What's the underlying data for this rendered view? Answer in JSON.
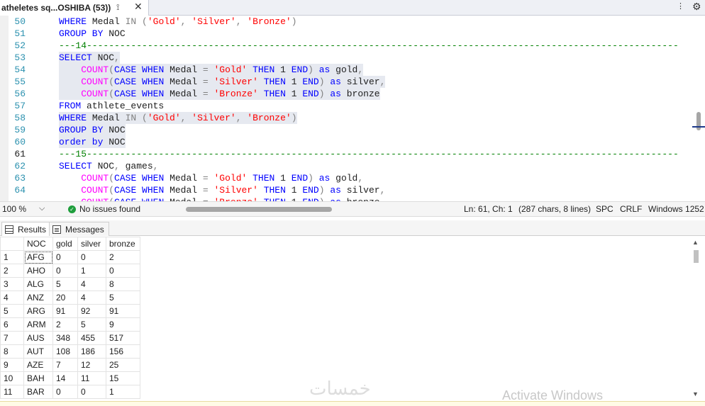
{
  "tab": {
    "title": "atheletes sq...OSHIBA (53))",
    "pin_glyph": "⟟",
    "close_glyph": "✕",
    "dropdown_glyph": "⋮",
    "settings_glyph": "⚙"
  },
  "editor": {
    "lines": [
      {
        "num": "50",
        "tokens": [
          [
            "kw",
            "WHERE "
          ],
          [
            "pl",
            "Medal "
          ],
          [
            "op",
            "IN "
          ],
          [
            "op",
            "("
          ],
          [
            "str",
            "'Gold'"
          ],
          [
            "op",
            ", "
          ],
          [
            "str",
            "'Silver'"
          ],
          [
            "op",
            ", "
          ],
          [
            "str",
            "'Bronze'"
          ],
          [
            "op",
            ")"
          ]
        ]
      },
      {
        "num": "51",
        "tokens": [
          [
            "kw",
            "GROUP BY "
          ],
          [
            "pl",
            "NOC"
          ]
        ]
      },
      {
        "num": "52",
        "tokens": [
          [
            "cm",
            "---14-----------------------------------------------------------------------------------------------------------"
          ]
        ]
      },
      {
        "num": "53",
        "hl": true,
        "tokens": [
          [
            "kw",
            "SELECT "
          ],
          [
            "pl",
            "NOC"
          ],
          [
            "op",
            ","
          ]
        ]
      },
      {
        "num": "54",
        "hl": true,
        "tokens": [
          [
            "pl",
            "    "
          ],
          [
            "fn",
            "COUNT"
          ],
          [
            "op",
            "("
          ],
          [
            "kw",
            "CASE WHEN "
          ],
          [
            "pl",
            "Medal "
          ],
          [
            "op",
            "= "
          ],
          [
            "str",
            "'Gold' "
          ],
          [
            "kw",
            "THEN "
          ],
          [
            "pl",
            "1 "
          ],
          [
            "kw",
            "END"
          ],
          [
            "op",
            ") "
          ],
          [
            "kw",
            "as "
          ],
          [
            "pl",
            "gold"
          ],
          [
            "op",
            ","
          ]
        ]
      },
      {
        "num": "55",
        "hl": true,
        "tokens": [
          [
            "pl",
            "    "
          ],
          [
            "fn",
            "COUNT"
          ],
          [
            "op",
            "("
          ],
          [
            "kw",
            "CASE WHEN "
          ],
          [
            "pl",
            "Medal "
          ],
          [
            "op",
            "= "
          ],
          [
            "str",
            "'Silver' "
          ],
          [
            "kw",
            "THEN "
          ],
          [
            "pl",
            "1 "
          ],
          [
            "kw",
            "END"
          ],
          [
            "op",
            ") "
          ],
          [
            "kw",
            "as "
          ],
          [
            "pl",
            "silver"
          ],
          [
            "op",
            ","
          ]
        ]
      },
      {
        "num": "56",
        "hl": true,
        "tokens": [
          [
            "pl",
            "    "
          ],
          [
            "fn",
            "COUNT"
          ],
          [
            "op",
            "("
          ],
          [
            "kw",
            "CASE WHEN "
          ],
          [
            "pl",
            "Medal "
          ],
          [
            "op",
            "= "
          ],
          [
            "str",
            "'Bronze' "
          ],
          [
            "kw",
            "THEN "
          ],
          [
            "pl",
            "1 "
          ],
          [
            "kw",
            "END"
          ],
          [
            "op",
            ") "
          ],
          [
            "kw",
            "as "
          ],
          [
            "pl",
            "bronze"
          ]
        ]
      },
      {
        "num": "57",
        "tokens": [
          [
            "kw",
            "FROM "
          ],
          [
            "pl",
            "athlete_events"
          ]
        ]
      },
      {
        "num": "58",
        "hl": true,
        "tokens": [
          [
            "kw",
            "WHERE "
          ],
          [
            "pl",
            "Medal "
          ],
          [
            "op",
            "IN "
          ],
          [
            "op",
            "("
          ],
          [
            "str",
            "'Gold'"
          ],
          [
            "op",
            ", "
          ],
          [
            "str",
            "'Silver'"
          ],
          [
            "op",
            ", "
          ],
          [
            "str",
            "'Bronze'"
          ],
          [
            "op",
            ")"
          ]
        ]
      },
      {
        "num": "59",
        "hl": true,
        "tokens": [
          [
            "kw",
            "GROUP BY "
          ],
          [
            "pl",
            "NOC"
          ]
        ]
      },
      {
        "num": "60",
        "hl": true,
        "tokens": [
          [
            "kw",
            "order by "
          ],
          [
            "pl",
            "NOC"
          ]
        ]
      },
      {
        "num": "61",
        "current": true,
        "tokens": [
          [
            "cm",
            "---15-----------------------------------------------------------------------------------------------------------"
          ]
        ]
      },
      {
        "num": "62",
        "tokens": [
          [
            "kw",
            "SELECT "
          ],
          [
            "pl",
            "NOC"
          ],
          [
            "op",
            ", "
          ],
          [
            "pl",
            "games"
          ],
          [
            "op",
            ","
          ]
        ]
      },
      {
        "num": "63",
        "tokens": [
          [
            "pl",
            "    "
          ],
          [
            "fn",
            "COUNT"
          ],
          [
            "op",
            "("
          ],
          [
            "kw",
            "CASE WHEN "
          ],
          [
            "pl",
            "Medal "
          ],
          [
            "op",
            "= "
          ],
          [
            "str",
            "'Gold' "
          ],
          [
            "kw",
            "THEN "
          ],
          [
            "pl",
            "1 "
          ],
          [
            "kw",
            "END"
          ],
          [
            "op",
            ") "
          ],
          [
            "kw",
            "as "
          ],
          [
            "pl",
            "gold"
          ],
          [
            "op",
            ","
          ]
        ]
      },
      {
        "num": "64",
        "tokens": [
          [
            "pl",
            "    "
          ],
          [
            "fn",
            "COUNT"
          ],
          [
            "op",
            "("
          ],
          [
            "kw",
            "CASE WHEN "
          ],
          [
            "pl",
            "Medal "
          ],
          [
            "op",
            "= "
          ],
          [
            "str",
            "'Silver' "
          ],
          [
            "kw",
            "THEN "
          ],
          [
            "pl",
            "1 "
          ],
          [
            "kw",
            "END"
          ],
          [
            "op",
            ") "
          ],
          [
            "kw",
            "as "
          ],
          [
            "pl",
            "silver"
          ],
          [
            "op",
            ","
          ]
        ]
      },
      {
        "num": "",
        "tokens": [
          [
            "pl",
            "    "
          ],
          [
            "fn",
            "COUNT"
          ],
          [
            "op",
            "("
          ],
          [
            "kw",
            "CASE WHEN "
          ],
          [
            "pl",
            "Medal "
          ],
          [
            "op",
            "= "
          ],
          [
            "str",
            "'Bronze' "
          ],
          [
            "kw",
            "THEN "
          ],
          [
            "pl",
            "1 "
          ],
          [
            "kw",
            "END"
          ],
          [
            "op",
            ") "
          ],
          [
            "kw",
            "as "
          ],
          [
            "pl",
            "bronze"
          ]
        ]
      }
    ]
  },
  "infobar": {
    "zoom": "100 %",
    "zoom_chevron": "⌵",
    "issues_glyph": "✓",
    "issues": "No issues found",
    "position": "Ln: 61, Ch: 1",
    "chars": "(287 chars, 8 lines)",
    "spacing": "SPC",
    "line_endings": "CRLF",
    "encoding": "Windows 1252"
  },
  "results_tabs": {
    "results": "Results",
    "messages": "Messages"
  },
  "grid": {
    "columns": [
      "NOC",
      "gold",
      "silver",
      "bronze"
    ],
    "rows": [
      [
        "1",
        "AFG",
        "0",
        "0",
        "2"
      ],
      [
        "2",
        "AHO",
        "0",
        "1",
        "0"
      ],
      [
        "3",
        "ALG",
        "5",
        "4",
        "8"
      ],
      [
        "4",
        "ANZ",
        "20",
        "4",
        "5"
      ],
      [
        "5",
        "ARG",
        "91",
        "92",
        "91"
      ],
      [
        "6",
        "ARM",
        "2",
        "5",
        "9"
      ],
      [
        "7",
        "AUS",
        "348",
        "455",
        "517"
      ],
      [
        "8",
        "AUT",
        "108",
        "186",
        "156"
      ],
      [
        "9",
        "AZE",
        "7",
        "12",
        "25"
      ],
      [
        "10",
        "BAH",
        "14",
        "11",
        "15"
      ],
      [
        "11",
        "BAR",
        "0",
        "0",
        "1"
      ]
    ]
  },
  "scroll": {
    "up_glyph": "▲",
    "down_glyph": "▼",
    "split_glyph": "⌸"
  },
  "watermark_logo": "خمسات",
  "watermark": "Activate Windows",
  "colors": {
    "keyword": "#0000ff",
    "function": "#ff00ff",
    "string": "#ff0000",
    "comment": "#008000",
    "line_number": "#2b91af",
    "selection": "#e6e9f0"
  }
}
